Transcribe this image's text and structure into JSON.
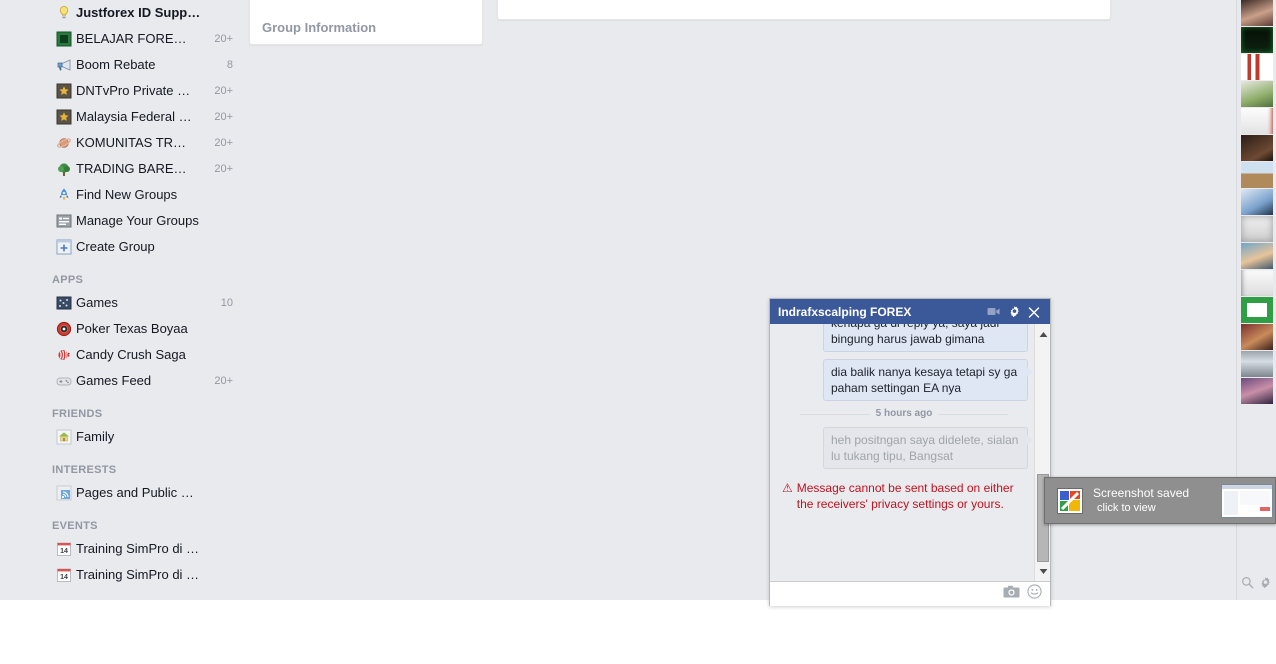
{
  "sidebar": {
    "groups": [
      {
        "label": "Justforex ID Supp…",
        "count": "",
        "icon": "lightbulb-icon",
        "unread": true
      },
      {
        "label": "BELAJAR FORE…",
        "count": "20+",
        "icon": "green-square-icon",
        "unread": false
      },
      {
        "label": "Boom Rebate",
        "count": "8",
        "icon": "megaphone-icon",
        "unread": false
      },
      {
        "label": "DNTvPro Private …",
        "count": "20+",
        "icon": "star-badge-icon",
        "unread": false
      },
      {
        "label": "Malaysia Federal …",
        "count": "20+",
        "icon": "star-badge-icon",
        "unread": false
      },
      {
        "label": "KOMUNITAS TR…",
        "count": "20+",
        "icon": "planet-icon",
        "unread": false
      },
      {
        "label": "TRADING BARE…",
        "count": "20+",
        "icon": "tree-icon",
        "unread": false
      },
      {
        "label": "Find New Groups",
        "count": "",
        "icon": "rocket-icon",
        "unread": false
      },
      {
        "label": "Manage Your Groups",
        "count": "",
        "icon": "list-icon",
        "unread": false
      },
      {
        "label": "Create Group",
        "count": "",
        "icon": "plus-box-icon",
        "unread": false
      }
    ],
    "apps_header": "APPS",
    "apps": [
      {
        "label": "Games",
        "count": "10",
        "icon": "games-icon"
      },
      {
        "label": "Poker Texas Boyaa",
        "count": "",
        "icon": "poker-chip-icon"
      },
      {
        "label": "Candy Crush Saga",
        "count": "",
        "icon": "candy-icon"
      },
      {
        "label": "Games Feed",
        "count": "20+",
        "icon": "gamepad-icon"
      }
    ],
    "friends_header": "FRIENDS",
    "friends": [
      {
        "label": "Family",
        "count": "",
        "icon": "house-icon"
      }
    ],
    "interests_header": "INTERESTS",
    "interests": [
      {
        "label": "Pages and Public …",
        "count": "",
        "icon": "rss-icon"
      }
    ],
    "events_header": "EVENTS",
    "events": [
      {
        "label": "Training SimPro di …",
        "count": "",
        "icon": "calendar-14-icon"
      },
      {
        "label": "Training SimPro di …",
        "count": "",
        "icon": "calendar-14-icon"
      }
    ]
  },
  "center": {
    "group_information_title": "Group Information"
  },
  "chat": {
    "title": "Indrafxscalping FOREX",
    "icons": {
      "video": "video-camera-icon",
      "settings": "gear-icon",
      "close": "close-icon",
      "scroll_up": "▲",
      "scroll_down": "▼"
    },
    "messages": [
      {
        "text": "kenapa ga di reply ya, saya jadi bingung harus jawab gimana",
        "state": "sent",
        "clipped": true
      },
      {
        "text": "dia balik nanya kesaya tetapi sy ga paham settingan EA nya",
        "state": "sent",
        "clipped": false
      }
    ],
    "timestamp": "5 hours ago",
    "pending_message": {
      "text": "heh positngan saya didelete, sialan lu tukang tipu, Bangsat",
      "state": "pending"
    },
    "error": {
      "symbol": "⚠",
      "text": "Message cannot be sent based on either the receivers' privacy settings or yours.",
      "color": "#c1121f"
    },
    "compose": {
      "camera_icon": "camera-icon",
      "emoji_icon": "smiley-icon"
    }
  },
  "right_rail": {
    "avatars": [
      "avatar-portrait-1",
      "avatar-chart-dark",
      "avatar-candlesticks",
      "avatar-money-house",
      "avatar-logo-red",
      "avatar-dark-photo",
      "avatar-illustration-1",
      "avatar-anime-1",
      "avatar-sketch",
      "avatar-kids",
      "avatar-drawing-hand",
      "avatar-amanah-logo",
      "avatar-group-photo",
      "avatar-screenshot",
      "avatar-family-photo"
    ],
    "search_icon": "search-icon",
    "settings_icon": "gear-icon"
  },
  "toast": {
    "title": "Screenshot saved",
    "subtitle": "click to view",
    "icon": "screenshot-app-icon",
    "thumbnail": "screenshot-thumbnail"
  },
  "colors": {
    "fb_blue": "#3b5998",
    "page_bg": "#e9eaed",
    "chat_bg": "#e9ebee",
    "bubble": "#dfe7f5",
    "error_red": "#c1121f",
    "muted": "#9197a3"
  }
}
